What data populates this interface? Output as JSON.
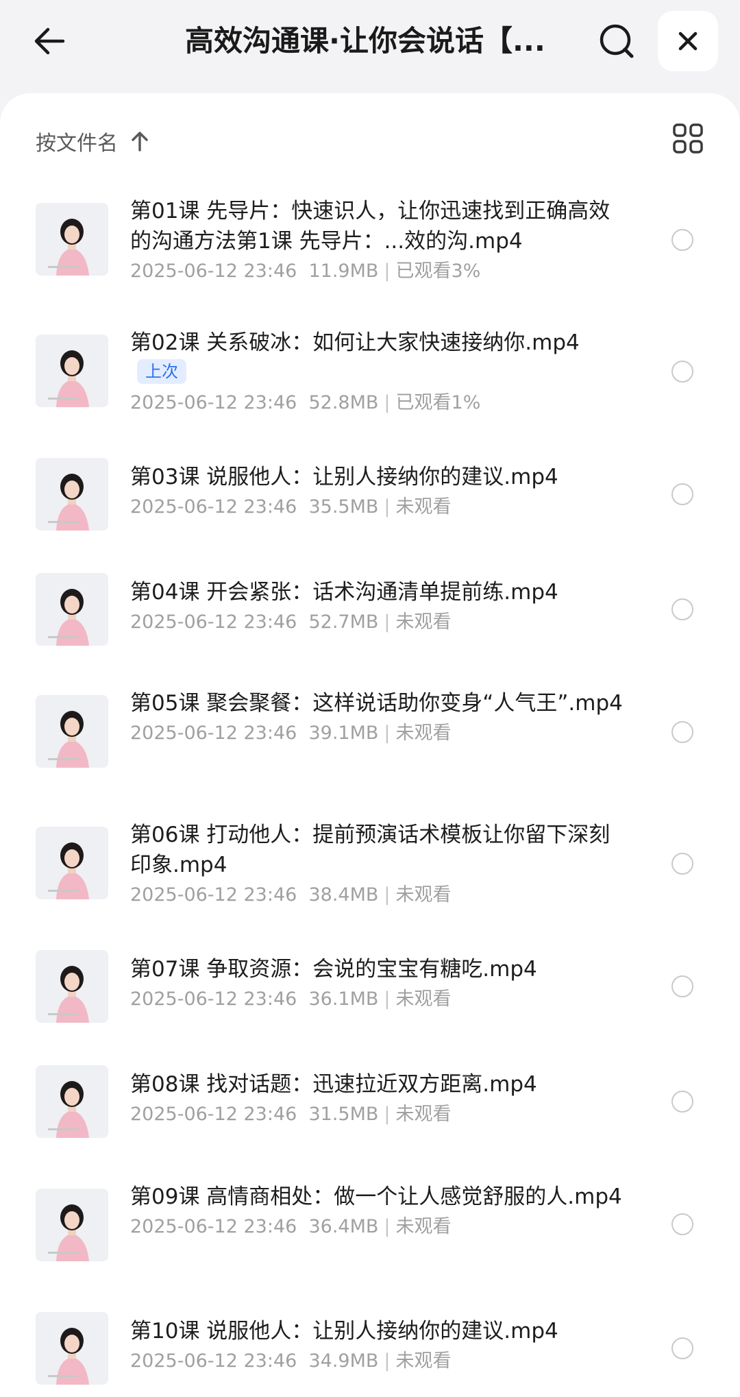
{
  "header": {
    "title": "高效沟通课·让你会说话【...",
    "back_icon": "arrow-left-icon",
    "search_icon": "search-icon",
    "close_icon": "close-icon"
  },
  "sortbar": {
    "label": "按文件名",
    "direction_icon": "arrow-up-icon",
    "view_icon": "grid-view-icon"
  },
  "files": [
    {
      "name": "第01课 先导片：快速识人，让你迅速找到正确高效的沟通方法第1课  先导片：...效的沟.mp4",
      "date": "2025-06-12 23:46",
      "size": "11.9MB",
      "status": "已观看3%",
      "badge": ""
    },
    {
      "name": "第02课 关系破冰：如何让大家快速接纳你.mp4",
      "date": "2025-06-12 23:46",
      "size": "52.8MB",
      "status": "已观看1%",
      "badge": "上次"
    },
    {
      "name": "第03课 说服他人：让别人接纳你的建议.mp4",
      "date": "2025-06-12 23:46",
      "size": "35.5MB",
      "status": "未观看",
      "badge": ""
    },
    {
      "name": "第04课 开会紧张：话术沟通清单提前练.mp4",
      "date": "2025-06-12 23:46",
      "size": "52.7MB",
      "status": "未观看",
      "badge": ""
    },
    {
      "name": "第05课  聚会聚餐：这样说话助你变身“人气王”.mp4",
      "date": "2025-06-12 23:46",
      "size": "39.1MB",
      "status": "未观看",
      "badge": ""
    },
    {
      "name": "第06课  打动他人：提前预演话术模板让你留下深刻印象.mp4",
      "date": "2025-06-12 23:46",
      "size": "38.4MB",
      "status": "未观看",
      "badge": ""
    },
    {
      "name": "第07课 争取资源：会说的宝宝有糖吃.mp4",
      "date": "2025-06-12 23:46",
      "size": "36.1MB",
      "status": "未观看",
      "badge": ""
    },
    {
      "name": "第08课 找对话题：迅速拉近双方距离.mp4",
      "date": "2025-06-12 23:46",
      "size": "31.5MB",
      "status": "未观看",
      "badge": ""
    },
    {
      "name": "第09课 高情商相处：做一个让人感觉舒服的人.mp4",
      "date": "2025-06-12 23:46",
      "size": "36.4MB",
      "status": "未观看",
      "badge": ""
    },
    {
      "name": "第10课 说服他人：让别人接纳你的建议.mp4",
      "date": "2025-06-12 23:46",
      "size": "34.9MB",
      "status": "未观看",
      "badge": ""
    }
  ]
}
